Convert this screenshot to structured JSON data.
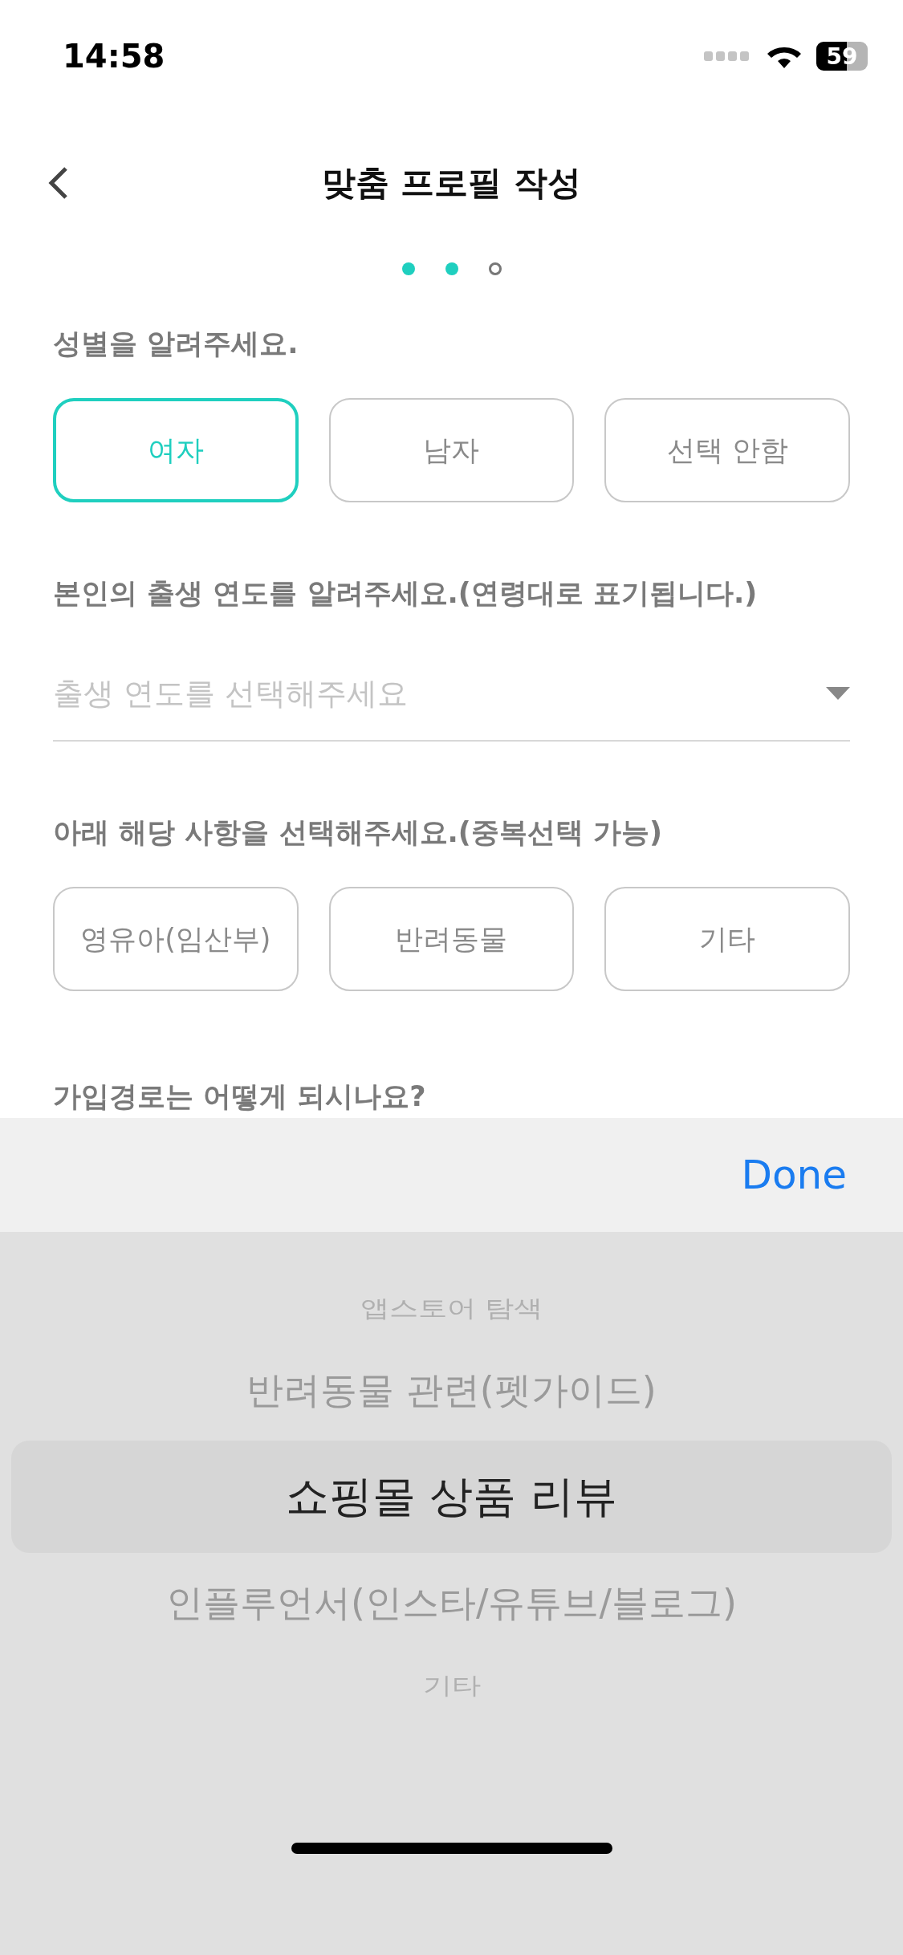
{
  "status_bar": {
    "time": "14:58",
    "battery": "59"
  },
  "header": {
    "title": "맞춤 프로필 작성"
  },
  "steps": [
    {
      "done": true
    },
    {
      "done": true
    },
    {
      "done": false
    }
  ],
  "gender": {
    "label": "성별을 알려주세요.",
    "options": [
      {
        "label": "여자",
        "selected": true
      },
      {
        "label": "남자",
        "selected": false
      },
      {
        "label": "선택 안함",
        "selected": false
      }
    ]
  },
  "birth_year": {
    "label": "본인의 출생 연도를 알려주세요.(연령대로 표기됩니다.)",
    "placeholder": "출생 연도를 선택해주세요"
  },
  "categories": {
    "label": "아래 해당 사항을 선택해주세요.(중복선택 가능)",
    "options": [
      {
        "label": "영유아(임산부)",
        "selected": false
      },
      {
        "label": "반려동물",
        "selected": false
      },
      {
        "label": "기타",
        "selected": false
      }
    ]
  },
  "signup_route": {
    "label": "가입경로는 어떻게 되시나요?"
  },
  "picker": {
    "done": "Done",
    "items": [
      {
        "label": "앱스토어 탐색",
        "selected": false
      },
      {
        "label": "반려동물 관련(펫가이드)",
        "selected": false
      },
      {
        "label": "쇼핑몰 상품 리뷰",
        "selected": true
      },
      {
        "label": "인플루언서(인스타/유튜브/블로그)",
        "selected": false
      },
      {
        "label": "기타",
        "selected": false
      }
    ]
  }
}
